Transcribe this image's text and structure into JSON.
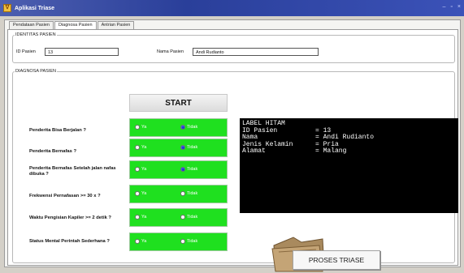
{
  "window": {
    "title": "Aplikasi Triase",
    "controls": [
      "–",
      "▫",
      "×"
    ]
  },
  "tabs": [
    "Pendataan Pasien",
    "Diagnosa Pasien",
    "Antrian Pasien"
  ],
  "identitas": {
    "legend": "IDENTITAS PASIEN",
    "id_label": "ID Pasien",
    "id_value": "13",
    "nama_label": "Nama Pasien",
    "nama_value": "Andi Rudianto"
  },
  "diagnosa": {
    "legend": "DIAGNOSA PASIEN",
    "start_label": "START",
    "option_yes": "Ya",
    "option_no": "Tidak",
    "questions": [
      {
        "text": "Penderita Bisa Berjalan ?",
        "selected": "Tidak"
      },
      {
        "text": "Penderita Bernafas ?",
        "selected": "Tidak"
      },
      {
        "text": "Penderita Bernafas Setelah jalan nafas dibuka ?",
        "selected": "Tidak"
      },
      {
        "text": "Frekwensi Pernafasan >= 30 x ?",
        "selected": ""
      },
      {
        "text": "Waktu Pengisian Kapiler >= 2 detik ?",
        "selected": ""
      },
      {
        "text": "Status Mental Perintah Sederhana ?",
        "selected": ""
      }
    ]
  },
  "info": {
    "title": "LABEL HITAM",
    "rows": [
      {
        "key": "ID Pasien",
        "value": "= 13"
      },
      {
        "key": "Nama",
        "value": "= Andi Rudianto"
      },
      {
        "key": "Jenis Kelamin",
        "value": "= Pria"
      },
      {
        "key": "Alamat",
        "value": "= Malang"
      }
    ]
  },
  "proses_label": "PROSES TRIASE",
  "colors": {
    "panel_green": "#1fe01f",
    "titlebar": "#2a3f9a",
    "radio_selected": "#1e3fd6"
  }
}
